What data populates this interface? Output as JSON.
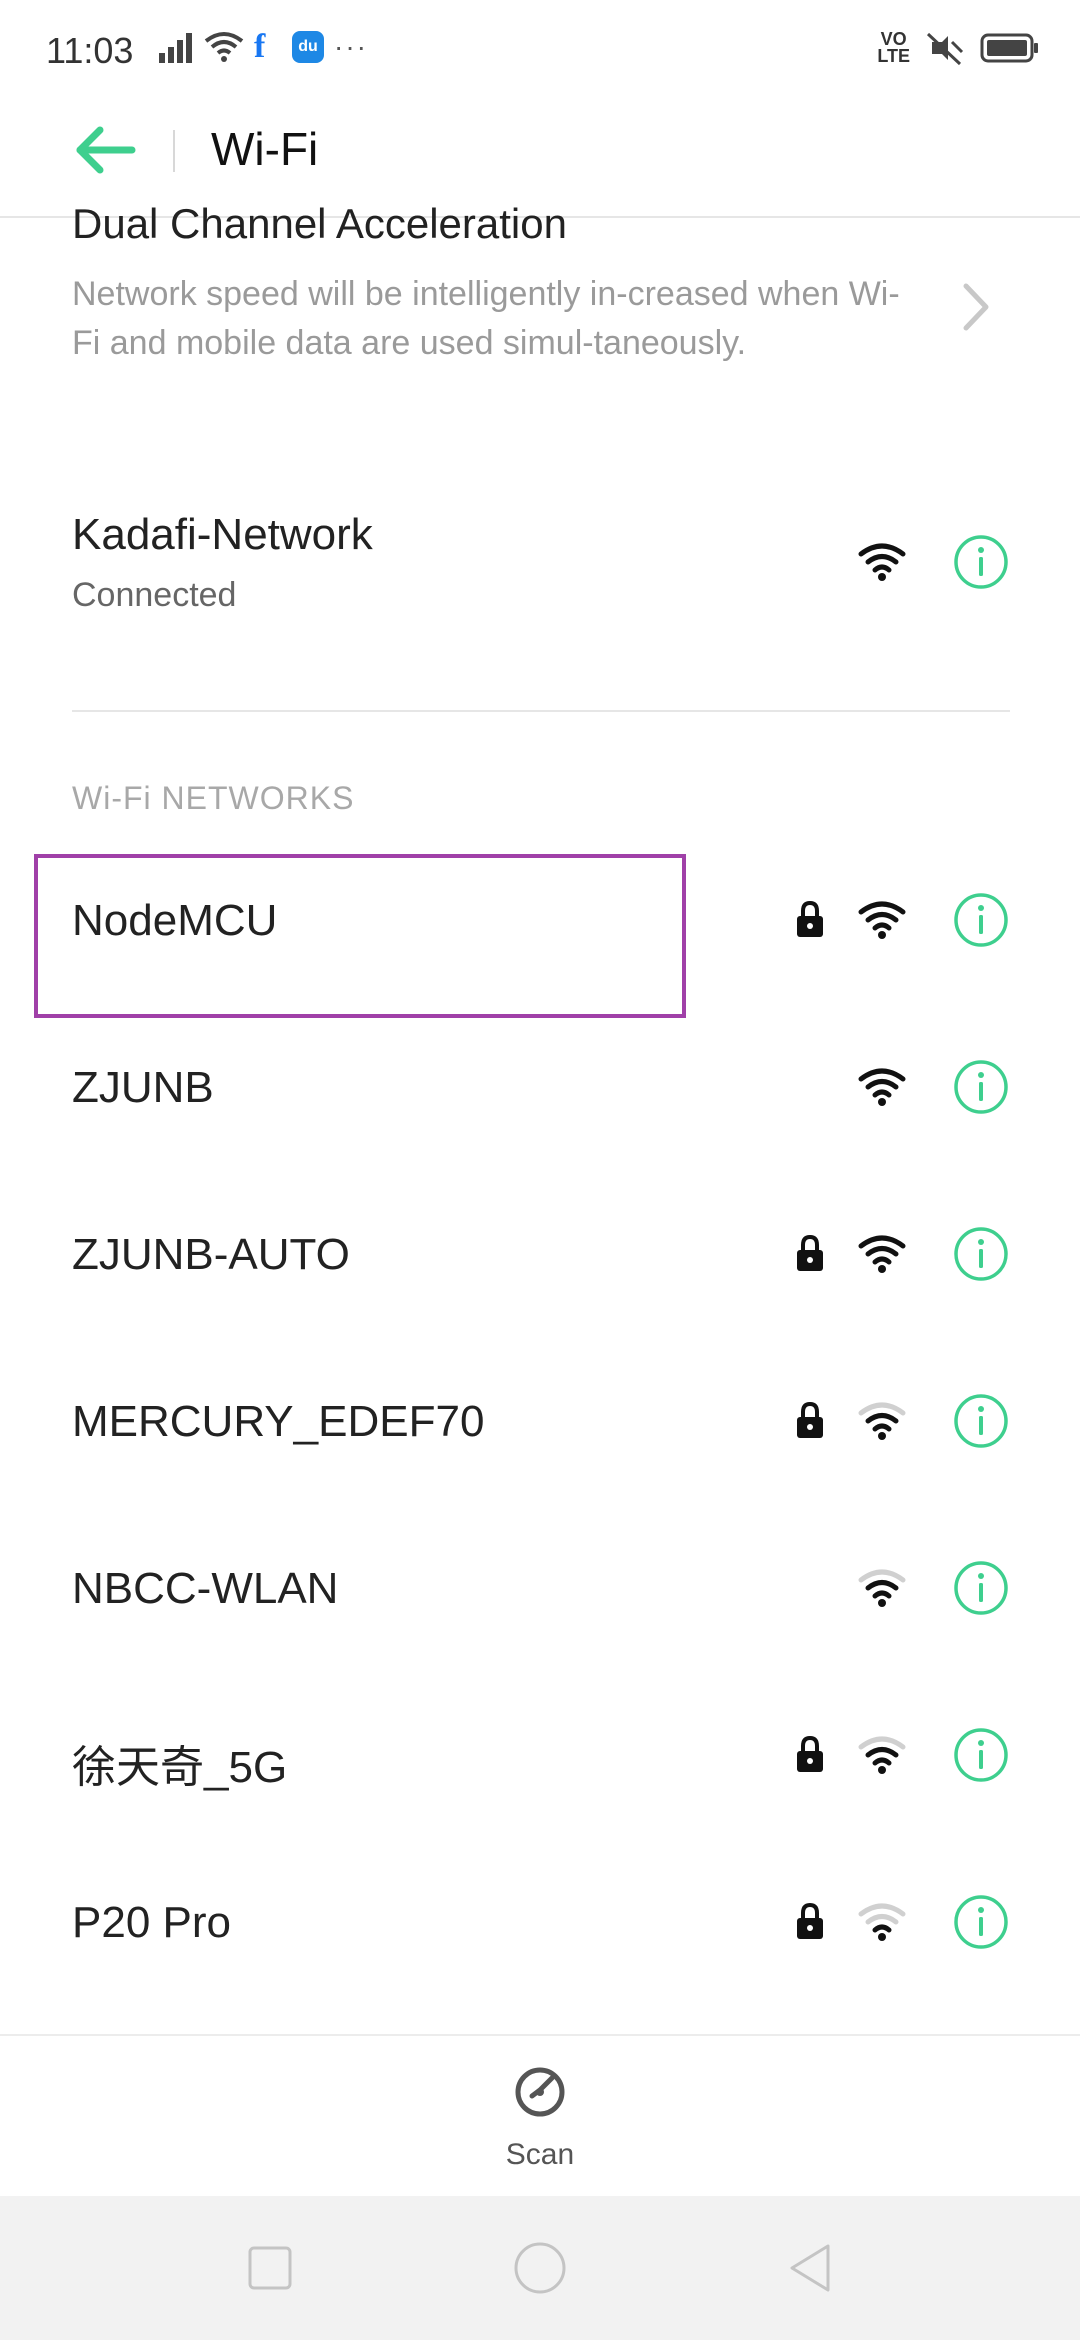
{
  "status_bar": {
    "time": "11:03",
    "fb_glyph": "f",
    "du_glyph": "du",
    "dots": "···",
    "volte_top": "VO",
    "volte_bottom": "LTE"
  },
  "header": {
    "title": "Wi-Fi",
    "accent_color": "#3ecf8e"
  },
  "dual_channel": {
    "title": "Dual Channel Acceleration",
    "description": "Network speed will be intelligently in-creased when Wi-Fi and mobile data are used simul-taneously."
  },
  "connected": {
    "name": "Kadafi-Network",
    "status": "Connected",
    "locked": false,
    "signal": "full"
  },
  "section_label": "Wi-Fi NETWORKS",
  "networks": [
    {
      "name": "NodeMCU",
      "locked": true,
      "signal": "full"
    },
    {
      "name": "ZJUNB",
      "locked": false,
      "signal": "full"
    },
    {
      "name": "ZJUNB-AUTO",
      "locked": true,
      "signal": "full"
    },
    {
      "name": "MERCURY_EDEF70",
      "locked": true,
      "signal": "medium"
    },
    {
      "name": "NBCC-WLAN",
      "locked": false,
      "signal": "medium"
    },
    {
      "name": "徐天奇_5G",
      "locked": true,
      "signal": "medium"
    },
    {
      "name": "P20 Pro",
      "locked": true,
      "signal": "low"
    }
  ],
  "scan": {
    "label": "Scan"
  }
}
